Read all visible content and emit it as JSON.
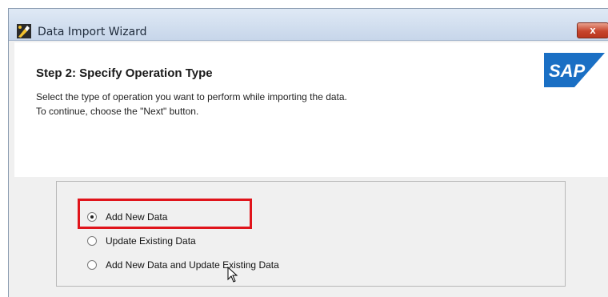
{
  "window": {
    "title": "Data Import Wizard",
    "app_icon": "wizard-icon",
    "close_icon": "close-icon",
    "close_label": "x"
  },
  "header": {
    "step_title": "Step 2: Specify Operation Type",
    "description_line1": "Select the type of operation you want to perform while importing the data.",
    "description_line2": "To continue, choose the \"Next\" button.",
    "logo_text": "SAP"
  },
  "operations": {
    "options": [
      {
        "label": "Add New Data",
        "selected": true
      },
      {
        "label": "Update Existing Data",
        "selected": false
      },
      {
        "label": "Add New Data and Update Existing Data",
        "selected": false
      }
    ]
  },
  "colors": {
    "highlight": "#e0141b",
    "sap_blue": "#1a6fc4"
  }
}
